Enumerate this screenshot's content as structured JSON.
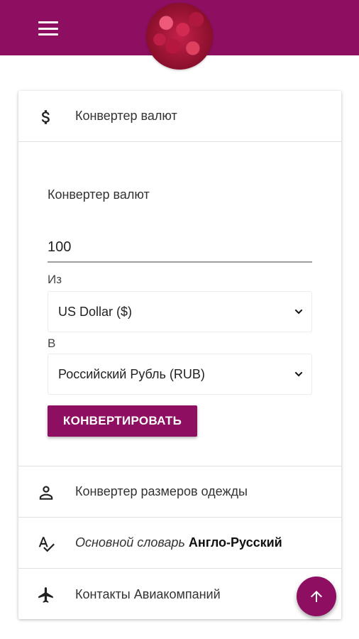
{
  "colors": {
    "brand": "#8e0f62"
  },
  "header": {
    "menu_icon": "hamburger-menu-icon",
    "avatar": "raspberry-avatar"
  },
  "sections": {
    "currency": {
      "icon": "dollar-icon",
      "label": "Конвертер валют",
      "panel_title": "Конвертер валют",
      "amount_value": "100",
      "from_label": "Из",
      "from_value": "US Dollar ($)",
      "to_label": "В",
      "to_value": "Российский Рубль (RUB)",
      "convert_button": "КОНВЕРТИРОВАТЬ"
    },
    "clothing": {
      "icon": "person-icon",
      "label": "Конвертер размеров одежды"
    },
    "dictionary": {
      "icon": "spellcheck-icon",
      "label_italic": "Основной словарь",
      "label_bold": "Англо-Русский"
    },
    "airlines": {
      "icon": "airplane-icon",
      "label": "Контакты Авиакомпаний"
    }
  },
  "fab": {
    "icon": "arrow-up-icon"
  }
}
